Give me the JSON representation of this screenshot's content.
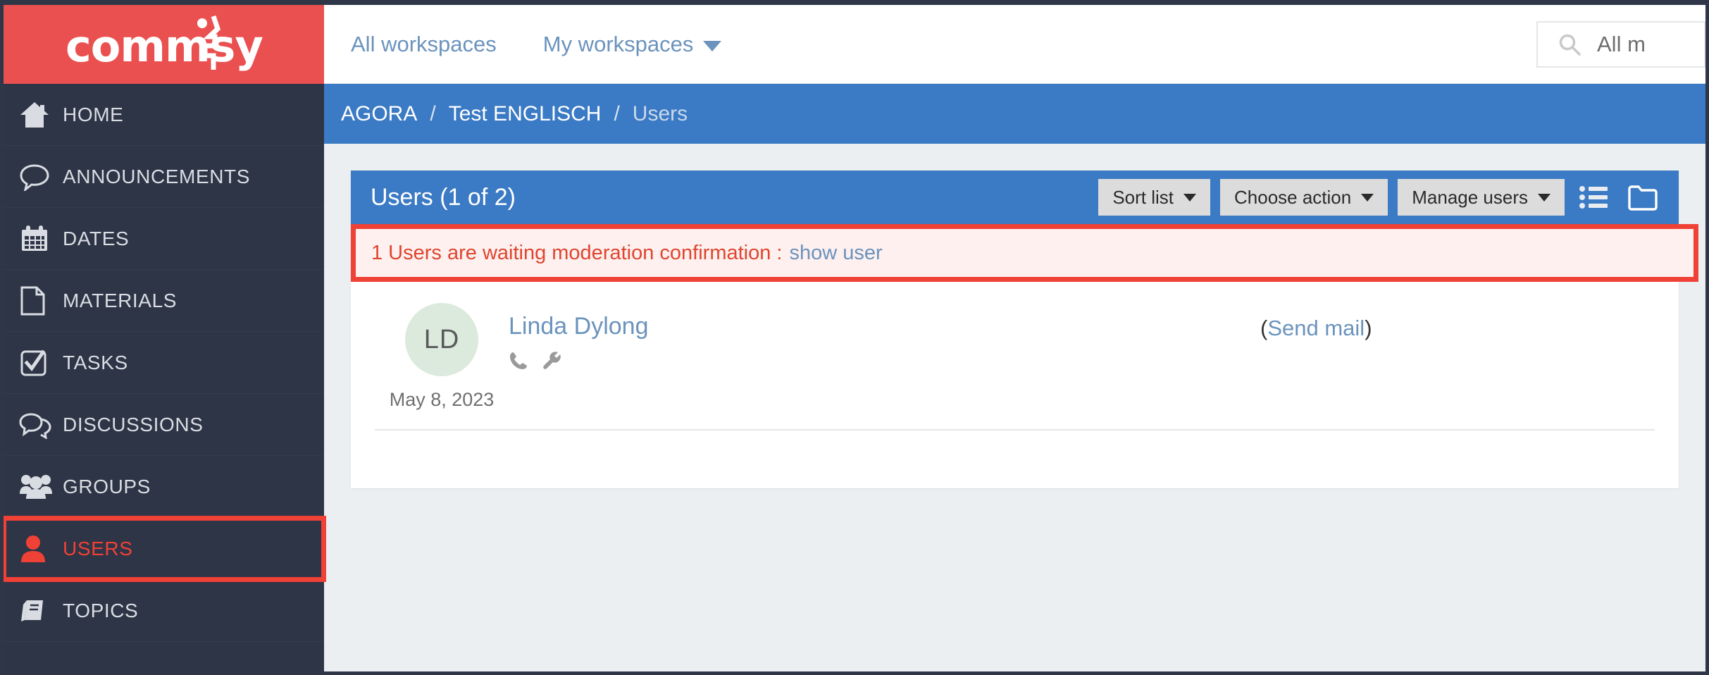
{
  "brand": {
    "name": "commsy",
    "logo_icon": "commsy-logo-figure",
    "background": "#ea5050"
  },
  "sidebar": {
    "items": [
      {
        "label": "HOME",
        "icon": "home-icon",
        "active": false,
        "highlighted": false
      },
      {
        "label": "ANNOUNCEMENTS",
        "icon": "speech-bubble-icon",
        "active": false,
        "highlighted": false
      },
      {
        "label": "DATES",
        "icon": "calendar-icon",
        "active": false,
        "highlighted": false
      },
      {
        "label": "MATERIALS",
        "icon": "document-icon",
        "active": false,
        "highlighted": false
      },
      {
        "label": "TASKS",
        "icon": "checkbox-checked-icon",
        "active": false,
        "highlighted": false
      },
      {
        "label": "DISCUSSIONS",
        "icon": "double-speech-bubble-icon",
        "active": false,
        "highlighted": false
      },
      {
        "label": "GROUPS",
        "icon": "people-group-icon",
        "active": false,
        "highlighted": false
      },
      {
        "label": "USERS",
        "icon": "person-icon",
        "active": true,
        "highlighted": true
      },
      {
        "label": "TOPICS",
        "icon": "book-icon",
        "active": false,
        "highlighted": false
      }
    ]
  },
  "topbar": {
    "links": [
      {
        "label": "All workspaces",
        "has_chevron": false
      },
      {
        "label": "My workspaces",
        "has_chevron": true
      }
    ],
    "search": {
      "icon": "search-icon",
      "placeholder": "All m"
    }
  },
  "breadcrumb": {
    "items": [
      {
        "label": "AGORA",
        "current": false
      },
      {
        "label": "Test ENGLISCH",
        "current": false
      },
      {
        "label": "Users",
        "current": true
      }
    ],
    "separator": "/"
  },
  "panel": {
    "title": "Users (1 of 2)",
    "actions": [
      {
        "label": "Sort list",
        "type": "dropdown"
      },
      {
        "label": "Choose action",
        "type": "dropdown"
      },
      {
        "label": "Manage users",
        "type": "dropdown"
      }
    ],
    "view_icons": [
      {
        "icon": "list-view-icon"
      },
      {
        "icon": "folder-icon"
      }
    ]
  },
  "alert": {
    "text": "1 Users are waiting moderation confirmation :",
    "link_label": "show user",
    "border_color": "#ef4136",
    "text_color": "#e0452f",
    "background": "#fdf0ef"
  },
  "users": [
    {
      "initials": "LD",
      "name": "Linda Dylong",
      "date": "May 8, 2023",
      "icons": [
        "phone-icon",
        "wrench-icon"
      ],
      "action_label": "(Send mail)",
      "action_open": "(",
      "action_text": "Send mail",
      "action_close": ")",
      "avatar_color": "#dbeadc"
    }
  ],
  "colors": {
    "sidebar": "#2e3546",
    "brand_red": "#ea5050",
    "accent_blue": "#3b7ac4",
    "link_blue": "#6b93bd",
    "highlight_red": "#ef4136"
  }
}
